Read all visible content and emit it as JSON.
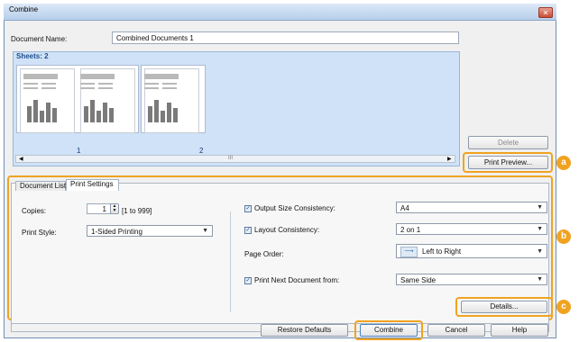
{
  "window": {
    "title": "Combine",
    "close_label": "✕"
  },
  "document_name": {
    "label": "Document Name:",
    "value": "Combined Documents 1"
  },
  "sheets": {
    "label": "Sheets: 2",
    "pages": [
      "1",
      "2"
    ],
    "scroll_mark": "III"
  },
  "side_buttons": {
    "delete": "Delete",
    "print_preview": "Print Preview..."
  },
  "tabs": [
    {
      "label": "Document List"
    },
    {
      "label": "Print Settings"
    }
  ],
  "print_settings": {
    "copies": {
      "label": "Copies:",
      "value": "1",
      "range": "[1 to 999]"
    },
    "print_style": {
      "label": "Print Style:",
      "value": "1-Sided Printing"
    },
    "output_size_consistency": {
      "label": "Output Size Consistency:",
      "value": "A4"
    },
    "layout_consistency": {
      "label": "Layout Consistency:",
      "value": "2 on 1"
    },
    "page_order": {
      "label": "Page Order:",
      "value": "Left to Right"
    },
    "print_next_document_from": {
      "label": "Print Next Document from:",
      "value": "Same Side"
    }
  },
  "details_button": "Details...",
  "bottom_buttons": {
    "restore_defaults": "Restore Defaults",
    "combine": "Combine",
    "cancel": "Cancel",
    "help": "Help"
  },
  "callouts": [
    "a",
    "b",
    "c"
  ],
  "colors": {
    "callout": "#f0a320",
    "sheet_area": "#cfe2f7"
  }
}
